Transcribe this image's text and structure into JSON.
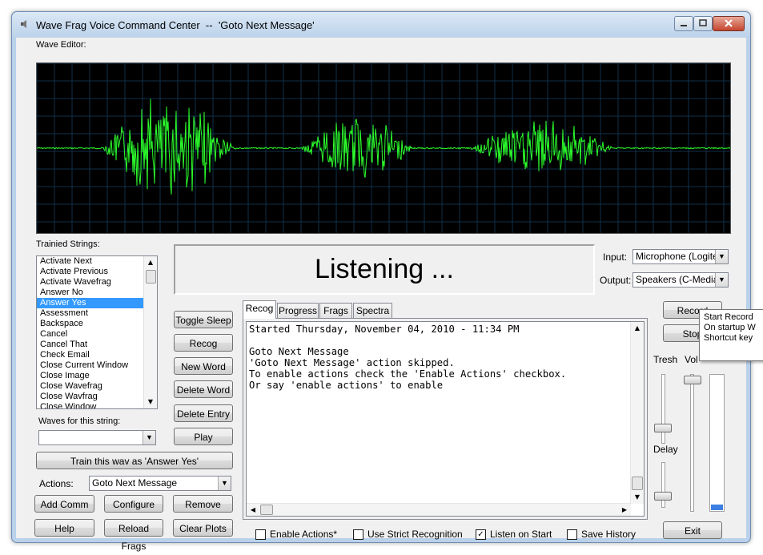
{
  "window": {
    "title": "Wave Frag Voice Command Center  --  'Goto Next Message'"
  },
  "wave_editor": {
    "label": "Wave Editor:",
    "trace_color": "#2cff2c",
    "grid_color": "#10304a"
  },
  "status_text": "Listening ...",
  "trained": {
    "label": "Trainied Strings:",
    "items": [
      "Activate Next",
      "Activate Previous",
      "Activate Wavefrag",
      "Answer No",
      "Answer Yes",
      "Assessment",
      "Backspace",
      "Cancel",
      "Cancel That",
      "Check Email",
      "Close Current Window",
      "Close Image",
      "Close Wavefrag",
      "Close Wavfrag",
      "Close Window"
    ],
    "selected": "Answer Yes"
  },
  "waves": {
    "label": "Waves for this string:",
    "value": ""
  },
  "train_button": "Train this wav as 'Answer Yes'",
  "actions": {
    "label": "Actions:",
    "value": "Goto Next Message"
  },
  "left_buttons": {
    "add_comm": "Add Comm",
    "configure": "Configure",
    "remove": "Remove",
    "help": "Help",
    "reload_frags": "Reload Frags",
    "clear_plots": "Clear Plots"
  },
  "middle_buttons": [
    "Toggle Sleep",
    "Recog",
    "New Word",
    "Delete Word",
    "Delete Entry",
    "Play"
  ],
  "io": {
    "input_label": "Input:",
    "input_value": "Microphone (Logitecl",
    "output_label": "Output:",
    "output_value": "Speakers (C-Media C"
  },
  "tabs": [
    "Recog",
    "Progress",
    "Frags",
    "Spectra"
  ],
  "active_tab": "Recog",
  "log_text": "Started Thursday, November 04, 2010 - 11:34 PM\n\nGoto Next Message\n'Goto Next Message' action skipped.\nTo enable actions check the 'Enable Actions' checkbox.\nOr say 'enable actions' to enable",
  "checkboxes": [
    {
      "label": "Enable Actions*",
      "checked": false
    },
    {
      "label": "Use Strict Recognition",
      "checked": false
    },
    {
      "label": "Listen on Start",
      "checked": true
    },
    {
      "label": "Save History",
      "checked": false
    }
  ],
  "right_panel": {
    "record": "Record",
    "stop": "Stop",
    "tresh": "Tresh",
    "vol": "Vol",
    "delay": "Delay",
    "exit": "Exit",
    "level_color": "#3d7fe0"
  },
  "tooltip": {
    "line1": "Start Record",
    "line2": "On startup W",
    "line3": "Shortcut key"
  }
}
